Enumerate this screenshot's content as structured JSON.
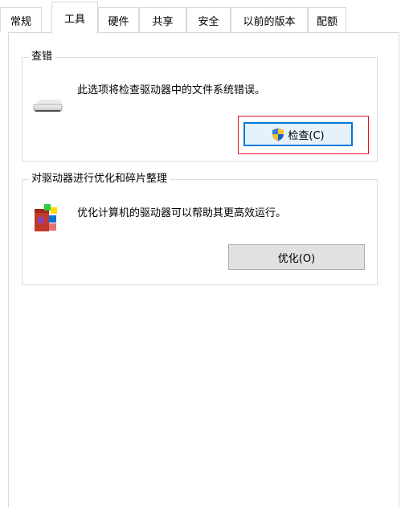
{
  "tabs": [
    {
      "label": "常规"
    },
    {
      "label": "工具"
    },
    {
      "label": "硬件"
    },
    {
      "label": "共享"
    },
    {
      "label": "安全"
    },
    {
      "label": "以前的版本"
    },
    {
      "label": "配额"
    }
  ],
  "active_tab": "工具",
  "check_group": {
    "title": "查错",
    "description": "此选项将检查驱动器中的文件系统错误。",
    "button_label": "检查(C)",
    "drive_icon": "drive-icon",
    "shield_icon": "uac-shield-icon"
  },
  "optimize_group": {
    "title": "对驱动器进行优化和碎片整理",
    "description": "优化计算机的驱动器可以帮助其更高效运行。",
    "button_label": "优化(O)",
    "defrag_icon": "defrag-icon"
  },
  "colors": {
    "focus_border": "#0078d7",
    "highlight_border": "#e81123",
    "button_face": "#e1e1e1"
  }
}
